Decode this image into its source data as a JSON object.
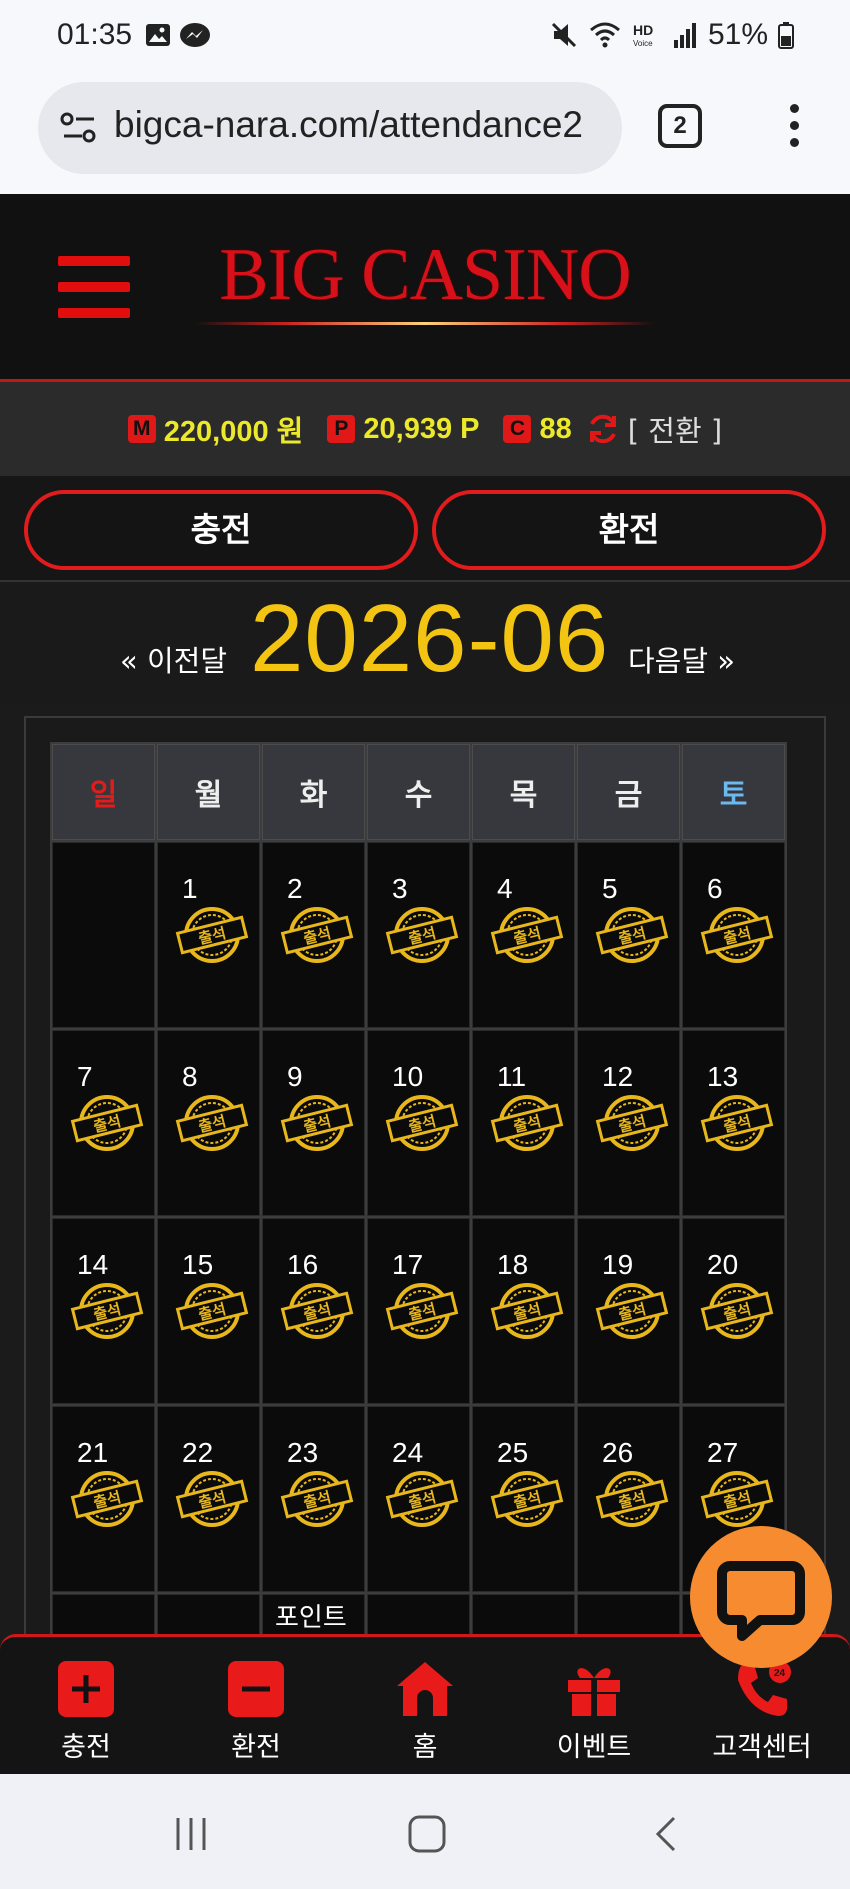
{
  "status_bar": {
    "time": "01:35",
    "battery": "51%",
    "icons": [
      "image-icon",
      "messenger-icon",
      "mute-icon",
      "wifi-icon",
      "hd-voice-icon",
      "signal-icon",
      "battery-icon"
    ]
  },
  "browser": {
    "url": "bigca-nara.com/attendance2",
    "tab_count": "2"
  },
  "header": {
    "logo": "BIG CASINO"
  },
  "balance": {
    "money_badge": "M",
    "money": "220,000 원",
    "point_badge": "P",
    "points": "20,939 P",
    "coin_badge": "C",
    "coins": "88",
    "convert": "[ 전환 ]"
  },
  "actions": {
    "deposit": "충전",
    "withdraw": "환전"
  },
  "calendar": {
    "title": "2026-06",
    "prev": "« 이전달",
    "next": "다음달 »",
    "weekdays": [
      "일",
      "월",
      "화",
      "수",
      "목",
      "금",
      "토"
    ],
    "stamp_label": "출석",
    "weeks": [
      [
        "",
        "1",
        "2",
        "3",
        "4",
        "5",
        "6"
      ],
      [
        "7",
        "8",
        "9",
        "10",
        "11",
        "12",
        "13"
      ],
      [
        "14",
        "15",
        "16",
        "17",
        "18",
        "19",
        "20"
      ],
      [
        "21",
        "22",
        "23",
        "24",
        "25",
        "26",
        "27"
      ]
    ],
    "partial_row_label": "포인트",
    "stamp_color": "#e8b71c"
  },
  "bottom_nav": [
    {
      "label": "충전",
      "icon": "plus-icon"
    },
    {
      "label": "환전",
      "icon": "minus-icon"
    },
    {
      "label": "홈",
      "icon": "home-icon"
    },
    {
      "label": "이벤트",
      "icon": "gift-icon"
    },
    {
      "label": "고객센터",
      "icon": "phone-24-icon"
    }
  ],
  "colors": {
    "accent_red": "#e01818",
    "gold": "#f3c512",
    "chat_orange": "#f68c2f"
  }
}
